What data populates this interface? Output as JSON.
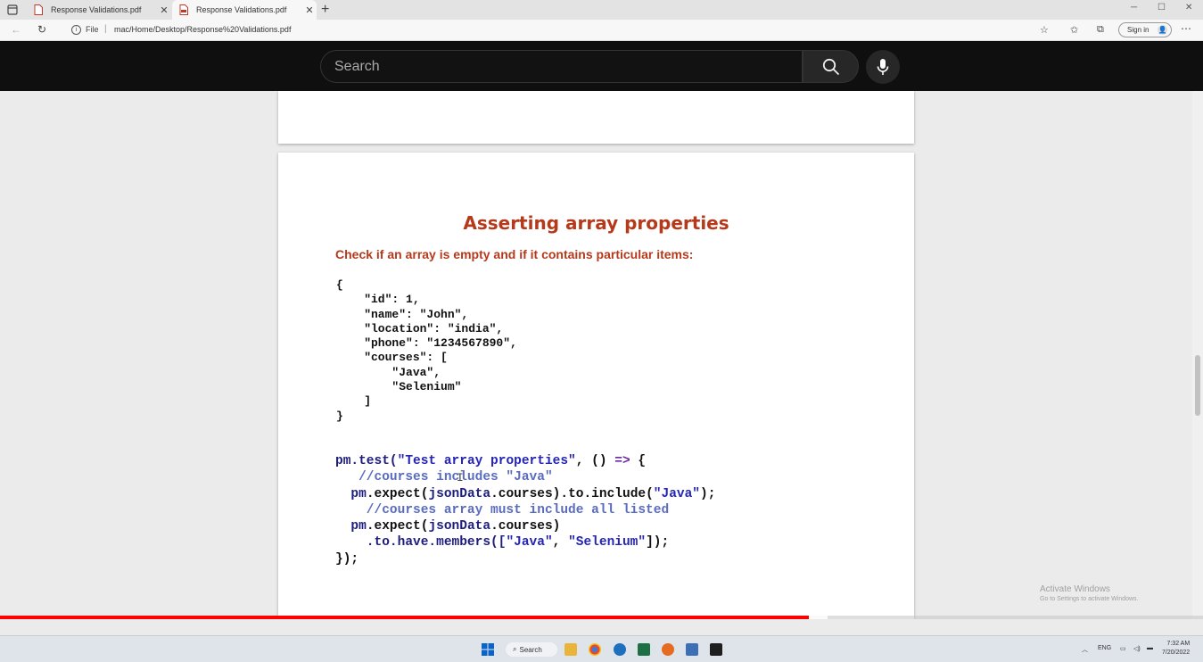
{
  "browser": {
    "tabs": [
      {
        "title": "Response Validations.pdf",
        "active": false
      },
      {
        "title": "Response Validations.pdf",
        "active": true
      }
    ],
    "address": {
      "scheme": "File",
      "path": "mac/Home/Desktop/Response%20Validations.pdf"
    },
    "signin_label": "Sign in"
  },
  "overlay": {
    "search_placeholder": "Search"
  },
  "pdf": {
    "title": "Asserting array properties",
    "subtitle": "Check if an array is empty and if it contains particular items:",
    "json_lines": [
      "{",
      "    \"id\": 1,",
      "    \"name\": \"John\",",
      "    \"location\": \"india\",",
      "    \"phone\": \"1234567890\",",
      "    \"courses\": [",
      "        \"Java\",",
      "        \"Selenium\"",
      "    ]",
      "}"
    ],
    "test_code": {
      "l1_obj": "pm",
      "l1_fn": ".test(",
      "l1_str": "\"Test array properties\"",
      "l1_mid": ", () ",
      "l1_arrow": "=>",
      "l1_end": " {",
      "l2_comment": "   //courses includes \"Java\"",
      "l3_obj": "  pm",
      "l3_a": ".expect(",
      "l3_b": "jsonData",
      "l3_c": ".courses).to.include(",
      "l3_str": "\"Java\"",
      "l3_end": ");",
      "l4_comment": "    //courses array must include all listed",
      "l5_obj": "  pm",
      "l5_a": ".expect(",
      "l5_b": "jsonData",
      "l5_c": ".courses)",
      "l6_a": "    .to.have.members([",
      "l6_s1": "\"Java\"",
      "l6_sep": ", ",
      "l6_s2": "\"Selenium\"",
      "l6_end": "]);",
      "l7": "});"
    }
  },
  "watermark": {
    "line1": "Activate Windows",
    "line2": "Go to Settings to activate Windows."
  },
  "video": {
    "progress": 0.672,
    "buffered": 0.688,
    "progress_color": "#ff0000"
  },
  "taskbar": {
    "search_label": "Search",
    "lang": "ENG",
    "time": "7:32 AM",
    "date": "7/20/2022"
  },
  "colors": {
    "accent_title": "#b5391b",
    "code_keyword": "#1d1d80",
    "code_string": "#2424b8",
    "code_comment": "#5a6cbf"
  }
}
